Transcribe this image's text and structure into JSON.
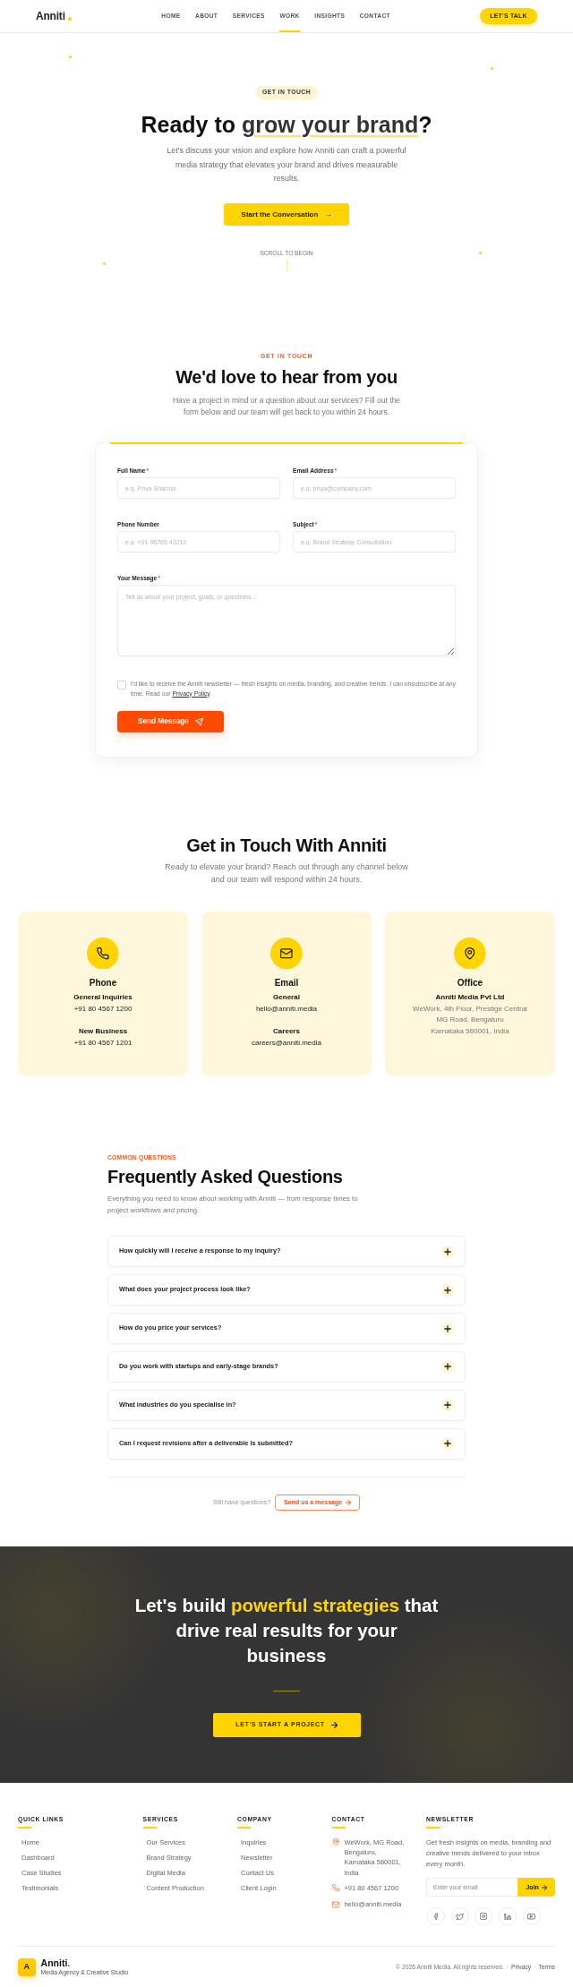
{
  "navbar": {
    "logo": "Anniti",
    "links": [
      {
        "label": "HOME",
        "selected": false
      },
      {
        "label": "ABOUT",
        "selected": false
      },
      {
        "label": "SERVICES",
        "selected": false
      },
      {
        "label": "WORK",
        "selected": true
      },
      {
        "label": "INSIGHTS",
        "selected": false
      },
      {
        "label": "CONTACT",
        "selected": false
      }
    ],
    "button": "LET'S TALK"
  },
  "hero": {
    "badge": "GET IN TOUCH",
    "title": [
      {
        "text": "Ready to ",
        "highlight": false
      },
      {
        "text": "grow your brand",
        "highlight": true
      },
      {
        "text": "?",
        "highlight": false
      }
    ],
    "text": "Let's discuss your vision and explore how Anniti can craft a powerful media strategy that elevates your brand and drives measurable results.",
    "button": {
      "label": "Start the Conversation",
      "arrow": "→"
    },
    "scroll_hint": "SCROLL TO BEGIN"
  },
  "contact_form": {
    "eyebrow": "GET IN TOUCH",
    "title": "We'd love to hear from you",
    "text": "Have a project in mind or a question about our services? Fill out the form below and our team will get back to you within 24 hours.",
    "fields": [
      {
        "kind": "input",
        "label": "Full Name",
        "mark": "*",
        "placeholder": "e.g. Priya Sharma"
      },
      {
        "kind": "input",
        "label": "Email Address",
        "mark": "*",
        "placeholder": "e.g. priya@company.com"
      },
      {
        "kind": "input",
        "label": "Phone Number",
        "placeholder": "e.g. +91 98765 43210"
      },
      {
        "kind": "input",
        "label": "Subject",
        "mark": "*",
        "placeholder": "e.g. Brand Strategy Consultation"
      },
      {
        "kind": "textarea",
        "label": "Your Message",
        "mark": "*",
        "placeholder": "Tell us about your project, goals, or questions..."
      }
    ],
    "consent": {
      "checked": false,
      "text": "I'd like to receive the Anniti newsletter — fresh insights on media, branding, and creative trends. I can unsubscribe at any time. Read our ",
      "link": "Privacy Policy",
      "after": "."
    },
    "submit": "Send Message"
  },
  "channels": {
    "title": "Get in Touch With Anniti",
    "text": "Ready to elevate your brand? Reach out through any channel below and our team will respond within 24 hours.",
    "cards": [
      {
        "kind": "phone",
        "title": "Phone",
        "groups": [
          {
            "label": "General Inquiries",
            "value": "+91 80 4567 1200"
          },
          {
            "label": "New Business",
            "value": "+91 80 4567 1201"
          }
        ]
      },
      {
        "kind": "email",
        "title": "Email",
        "groups": [
          {
            "label": "General",
            "value": "hello@anniti.media"
          },
          {
            "label": "Careers",
            "value": "careers@anniti.media"
          }
        ]
      },
      {
        "kind": "office",
        "title": "Office",
        "groups": [
          {
            "label": "Anniti Media Pvt Ltd",
            "lines": [
              "WeWork, 4th Floor, Prestige Central",
              "MG Road, Bengaluru",
              "Karnataka 560001, India"
            ]
          }
        ]
      }
    ]
  },
  "faq": {
    "eyebrow": "COMMON QUESTIONS",
    "title": "Frequently Asked Questions",
    "text": "Everything you need to know about working with Anniti — from response times to project workflows and pricing.",
    "items": [
      {
        "question": "How quickly will I receive a response to my inquiry?",
        "expanded": false
      },
      {
        "question": "What does your project process look like?",
        "expanded": false
      },
      {
        "question": "How do you price your services?",
        "expanded": false
      },
      {
        "question": "Do you work with startups and early-stage brands?",
        "expanded": false
      },
      {
        "question": "What industries do you specialise in?",
        "expanded": false
      },
      {
        "question": "Can I request revisions after a deliverable is submitted?",
        "expanded": false
      }
    ],
    "more_text": "Still have questions?",
    "more_button": "Send us a message"
  },
  "cta": {
    "title": [
      {
        "text": "Let's build ",
        "highlight": false
      },
      {
        "text": "powerful strategies",
        "highlight": true
      },
      {
        "text": " that drive real results for your business",
        "highlight": false
      }
    ],
    "button": "LET'S START A PROJECT"
  },
  "footer": {
    "columns": [
      {
        "kind": "links",
        "title": "QUICK LINKS",
        "links": [
          "Home",
          "Dashboard",
          "Case Studies",
          "Testimonials"
        ]
      },
      {
        "kind": "links",
        "title": "SERVICES",
        "links": [
          "Our Services",
          "Brand Strategy",
          "Digital Media",
          "Content Production"
        ]
      },
      {
        "kind": "links",
        "title": "COMPANY",
        "links": [
          "Inquiries",
          "Newsletter",
          "Contact Us",
          "Client Login"
        ]
      },
      {
        "kind": "contact",
        "title": "CONTACT",
        "items": [
          {
            "kind": "address",
            "text": "WeWork, MG Road, Bengaluru, Karnataka 560001, India"
          },
          {
            "kind": "phone",
            "text": "+91 80 4567 1200"
          },
          {
            "kind": "email",
            "text": "hello@anniti.media"
          }
        ]
      },
      {
        "kind": "newsletter",
        "title": "NEWSLETTER",
        "text": "Get fresh insights on media, branding and creative trends delivered to your inbox every month.",
        "placeholder": "Enter your email",
        "button": "Join"
      }
    ],
    "brand": {
      "mark": "A",
      "name": "Anniti",
      "accent": ".",
      "tagline": "Media Agency & Creative Studio"
    },
    "legal": [
      {
        "kind": "text",
        "text": "© 2026 Anniti Media. All rights reserved."
      },
      {
        "kind": "separator",
        "text": "·"
      },
      {
        "kind": "link",
        "text": "Privacy"
      },
      {
        "kind": "separator",
        "text": "·"
      },
      {
        "kind": "link",
        "text": "Terms"
      }
    ]
  }
}
